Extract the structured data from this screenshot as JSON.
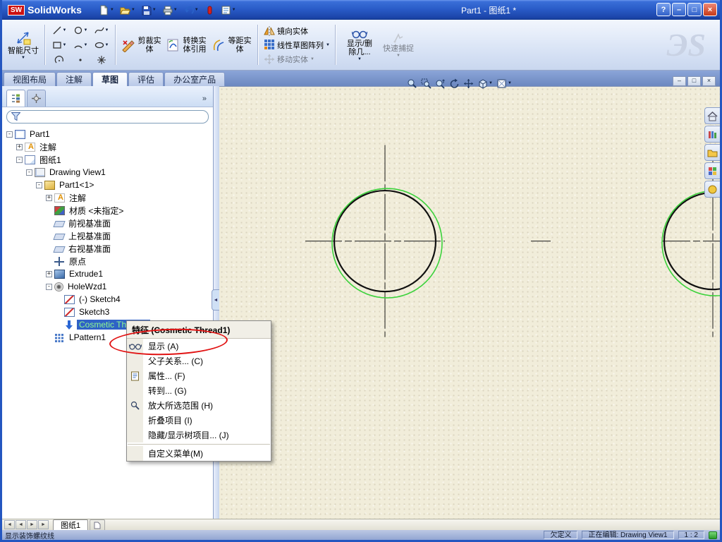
{
  "window": {
    "logo_abbr": "SW",
    "brand": "SolidWorks",
    "title": "Part1 - 图纸1 *",
    "controls": {
      "help": "?",
      "minimize": "–",
      "maximize": "□",
      "close": "×"
    },
    "doc_controls": {
      "minimize": "–",
      "restore": "□",
      "close": "×"
    }
  },
  "icons": {
    "caret": "▼",
    "overflow": "»",
    "collapse_left": "◄",
    "nav_first": "◄",
    "nav_prev": "◄",
    "nav_next": "►",
    "nav_last": "►"
  },
  "toolbar": {
    "smart_dimension": "智能尺寸",
    "trim": "剪裁实体",
    "convert": "转换实体引用",
    "offset": "等距实体",
    "mirror": "镜向实体",
    "linear_pattern": "线性草图阵列",
    "move": "移动实体",
    "display_delete": "显示/删除几...",
    "quick_snaps": "快速捕捉",
    "ds_logo": "ЭS"
  },
  "ribbon_tabs": [
    {
      "label": "视图布局",
      "active": false
    },
    {
      "label": "注解",
      "active": false
    },
    {
      "label": "草图",
      "active": true
    },
    {
      "label": "评估",
      "active": false
    },
    {
      "label": "办公室产品",
      "active": false
    }
  ],
  "panel": {
    "filter_value": "",
    "tree": [
      {
        "label": "Part1",
        "expand": "-"
      },
      {
        "label": "注解",
        "expand": "+"
      },
      {
        "label": "图纸1",
        "expand": "-"
      },
      {
        "label": "Drawing View1",
        "expand": "-"
      },
      {
        "label": "Part1<1>",
        "expand": "-"
      },
      {
        "label": "注解",
        "expand": "+"
      },
      {
        "label": "材质 <未指定>",
        "expand": ""
      },
      {
        "label": "前视基准面",
        "expand": ""
      },
      {
        "label": "上视基准面",
        "expand": ""
      },
      {
        "label": "右视基准面",
        "expand": ""
      },
      {
        "label": "原点",
        "expand": ""
      },
      {
        "label": "Extrude1",
        "expand": "+"
      },
      {
        "label": "HoleWzd1",
        "expand": "-"
      },
      {
        "label": "(-) Sketch4",
        "expand": ""
      },
      {
        "label": "Sketch3",
        "expand": ""
      },
      {
        "label": "Cosmetic Thread1",
        "expand": "",
        "selected": true
      },
      {
        "label": "LPattern1",
        "expand": ""
      }
    ]
  },
  "context_menu": {
    "title": "特征 (Cosmetic Thread1)",
    "items": [
      {
        "label": "显示 (A)"
      },
      {
        "label": "父子关系... (C)"
      },
      {
        "label": "属性... (F)"
      },
      {
        "label": "转到... (G)"
      },
      {
        "label": "放大所选范围 (H)"
      },
      {
        "label": "折叠项目 (I)"
      },
      {
        "label": "隐藏/显示树项目... (J)"
      },
      {
        "label": "自定义菜单(M)"
      }
    ]
  },
  "sheetbar": {
    "sheet_tab": "图纸1"
  },
  "statusbar": {
    "message": "显示装饰螺纹线",
    "state": "欠定义",
    "editing": "正在编辑: Drawing View1",
    "scale": "1 : 2"
  }
}
